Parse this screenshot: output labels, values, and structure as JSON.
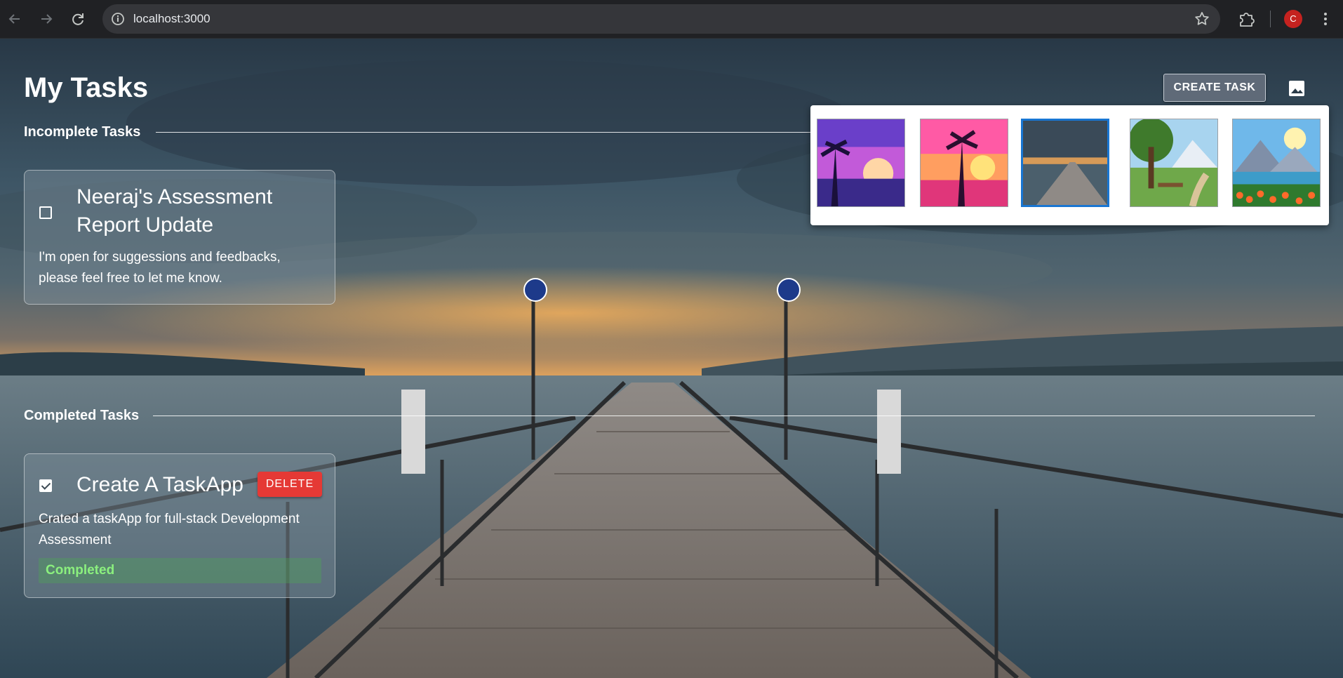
{
  "browser": {
    "url": "localhost:3000",
    "profile_initial": "C"
  },
  "header": {
    "title": "My Tasks",
    "create_button_label": "CREATE TASK"
  },
  "sections": {
    "incomplete": {
      "label": "Incomplete Tasks",
      "tasks": [
        {
          "title": "Neeraj's Assessment Report Update",
          "description": "I'm open for suggessions and feedbacks, please feel free to let me know.",
          "checked": false
        }
      ]
    },
    "completed": {
      "label": "Completed Tasks",
      "tasks": [
        {
          "title": "Create A TaskApp",
          "description": "Crated a taskApp for full-stack Development Assessment",
          "checked": true,
          "delete_label": "DELETE",
          "status": "Completed"
        }
      ]
    }
  },
  "background_picker": {
    "options": [
      {
        "name": "purple-palm-sunset",
        "selected": false
      },
      {
        "name": "pink-palm-sunset",
        "selected": false
      },
      {
        "name": "pier-lake-dusk",
        "selected": true
      },
      {
        "name": "forest-bench-path",
        "selected": false
      },
      {
        "name": "mountain-lake-flowers",
        "selected": false
      }
    ]
  },
  "colors": {
    "accent_selected": "#1976d2",
    "delete": "#e53935",
    "status_completed_text": "#8bf07e",
    "create_button": "#5f6a78"
  }
}
